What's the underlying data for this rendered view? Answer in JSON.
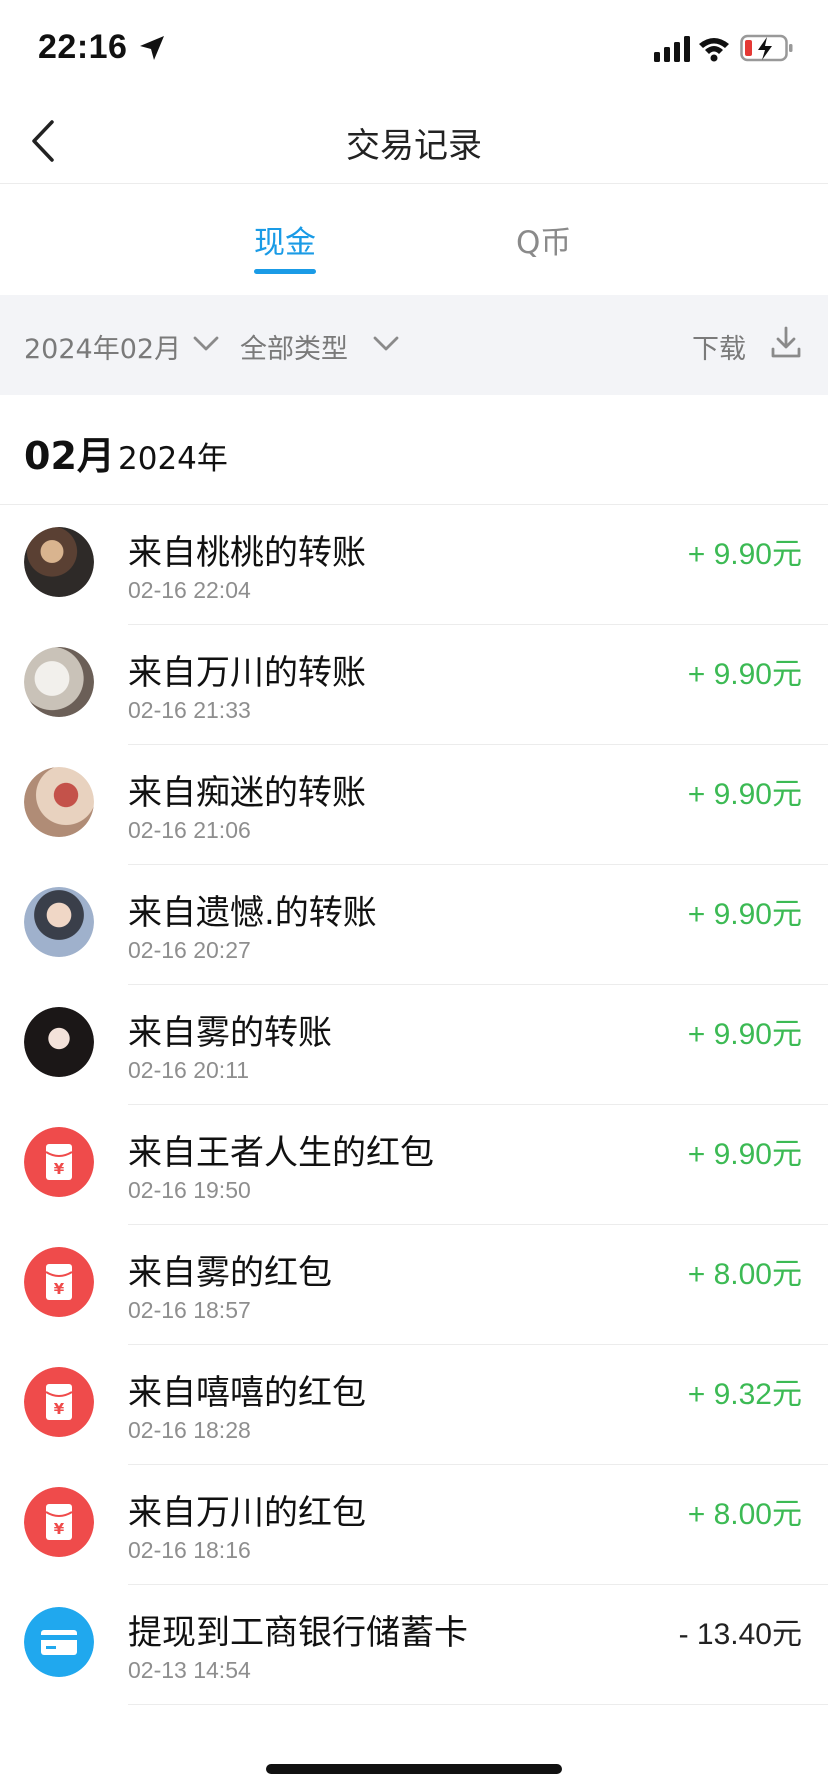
{
  "status_bar": {
    "time": "22:16"
  },
  "nav": {
    "title": "交易记录"
  },
  "tabs": [
    {
      "label": "现金",
      "active": true
    },
    {
      "label": "Q币",
      "active": false
    }
  ],
  "filters": {
    "month": "2024年02月",
    "type": "全部类型",
    "download": "下载"
  },
  "month_header": {
    "month": "02月",
    "year": "2024年"
  },
  "colors": {
    "accent": "#1a9be6",
    "income": "#3cba54",
    "red_packet": "#ef4b4b",
    "card": "#20a8ee"
  },
  "transactions": [
    {
      "title": "来自桃桃的转账",
      "time": "02-16 22:04",
      "amount": "+ 9.90",
      "unit": "元",
      "icon": "avatar-photo"
    },
    {
      "title": "来自万川的转账",
      "time": "02-16 21:33",
      "amount": "+ 9.90",
      "unit": "元",
      "icon": "avatar-photo"
    },
    {
      "title": "来自痴迷的转账",
      "time": "02-16 21:06",
      "amount": "+ 9.90",
      "unit": "元",
      "icon": "avatar-photo"
    },
    {
      "title": "来自遗憾.的转账",
      "time": "02-16 20:27",
      "amount": "+ 9.90",
      "unit": "元",
      "icon": "avatar-photo"
    },
    {
      "title": "来自雾的转账",
      "time": "02-16 20:11",
      "amount": "+ 9.90",
      "unit": "元",
      "icon": "avatar-photo"
    },
    {
      "title": "来自王者人生的红包",
      "time": "02-16 19:50",
      "amount": "+ 9.90",
      "unit": "元",
      "icon": "red-packet-icon"
    },
    {
      "title": "来自雾的红包",
      "time": "02-16 18:57",
      "amount": "+ 8.00",
      "unit": "元",
      "icon": "red-packet-icon"
    },
    {
      "title": "来自嘻嘻的红包",
      "time": "02-16 18:28",
      "amount": "+ 9.32",
      "unit": "元",
      "icon": "red-packet-icon"
    },
    {
      "title": "来自万川的红包",
      "time": "02-16 18:16",
      "amount": "+ 8.00",
      "unit": "元",
      "icon": "red-packet-icon"
    },
    {
      "title": "提现到工商银行储蓄卡",
      "time": "02-13 14:54",
      "amount": "- 13.40",
      "unit": "元",
      "icon": "bank-card-icon"
    }
  ]
}
